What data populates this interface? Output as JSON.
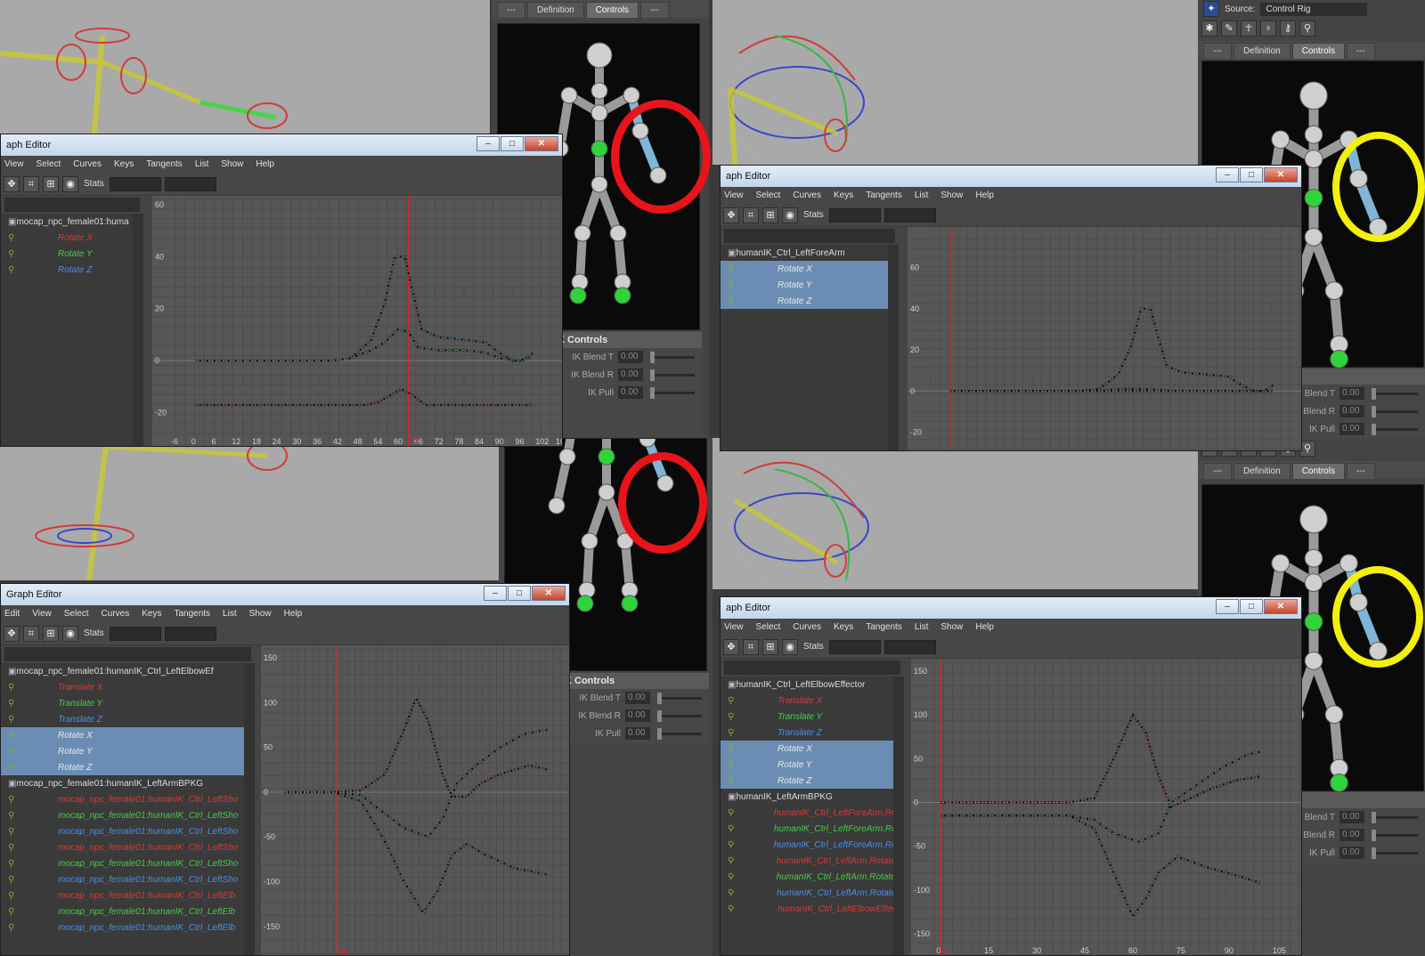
{
  "ik_tabs": {
    "left": "---",
    "definition": "Definition",
    "controls": "Controls",
    "right": "---"
  },
  "ik_top_right_source": {
    "label": "Source:",
    "value": "Control Rig"
  },
  "ik_controls_header_mid": "K Controls",
  "ik_controls_header_mid_top": "K Controls",
  "ik_controls_header_right": "trols",
  "ik_rows": [
    {
      "label": "IK Blend T",
      "value": "0.00"
    },
    {
      "label": "IK Blend R",
      "value": "0.00"
    },
    {
      "label": "IK Pull",
      "value": "0.00"
    }
  ],
  "ik_rows_right": [
    {
      "label": "Blend T",
      "value": "0.00"
    },
    {
      "label": "Blend R",
      "value": "0.00"
    },
    {
      "label": "IK Pull",
      "value": "0.00"
    }
  ],
  "highlight_colors": {
    "red": "#e8141a",
    "yellow": "#f3f00b"
  },
  "windows": {
    "tl": {
      "title": "aph Editor",
      "menu": [
        "View",
        "Select",
        "Curves",
        "Keys",
        "Tangents",
        "List",
        "Show",
        "Help"
      ],
      "stats": "Stats",
      "outliner": [
        {
          "text": "mocap_npc_female01:huma",
          "kind": "node",
          "color": "#e5e5e5"
        },
        {
          "text": "Rotate X",
          "kind": "curve",
          "color": "#d93a3a"
        },
        {
          "text": "Rotate Y",
          "kind": "curve",
          "color": "#49c94b"
        },
        {
          "text": "Rotate Z",
          "kind": "curve",
          "color": "#4a8fe8"
        }
      ]
    },
    "tr": {
      "title": "aph Editor",
      "menu": [
        "View",
        "Select",
        "Curves",
        "Keys",
        "Tangents",
        "List",
        "Show",
        "Help"
      ],
      "stats": "Stats",
      "outliner": [
        {
          "text": "humanIK_Ctrl_LeftForeArm",
          "kind": "node",
          "color": "#e5e5e5"
        },
        {
          "text": "Rotate X",
          "kind": "curve",
          "color": "#e8e8e8",
          "sel": true
        },
        {
          "text": "Rotate Y",
          "kind": "curve",
          "color": "#e8e8e8",
          "sel": true
        },
        {
          "text": "Rotate Z",
          "kind": "curve",
          "color": "#e8e8e8",
          "sel": true
        }
      ]
    },
    "bl": {
      "title": "Graph Editor",
      "menu": [
        "Edit",
        "View",
        "Select",
        "Curves",
        "Keys",
        "Tangents",
        "List",
        "Show",
        "Help"
      ],
      "stats": "Stats",
      "outliner": [
        {
          "text": "mocap_npc_female01:humanIK_Ctrl_LeftElbowEf",
          "kind": "node",
          "color": "#e5e5e5"
        },
        {
          "text": "Translate X",
          "kind": "curve",
          "color": "#d93a3a"
        },
        {
          "text": "Translate Y",
          "kind": "curve",
          "color": "#49c94b"
        },
        {
          "text": "Translate Z",
          "kind": "curve",
          "color": "#4a8fe8"
        },
        {
          "text": "Rotate X",
          "kind": "curve",
          "color": "#e8e8e8",
          "sel": true
        },
        {
          "text": "Rotate Y",
          "kind": "curve",
          "color": "#e8e8e8",
          "sel": true
        },
        {
          "text": "Rotate Z",
          "kind": "curve",
          "color": "#e8e8e8",
          "sel": true
        },
        {
          "text": "mocap_npc_female01:humanIK_LeftArmBPKG",
          "kind": "node",
          "color": "#e5e5e5"
        },
        {
          "text": "mocap_npc_female01:humanIK_Ctrl_LeftSho",
          "kind": "curve",
          "color": "#d93a3a"
        },
        {
          "text": "mocap_npc_female01:humanIK_Ctrl_LeftSho",
          "kind": "curve",
          "color": "#49c94b"
        },
        {
          "text": "mocap_npc_female01:humanIK_Ctrl_LeftSho",
          "kind": "curve",
          "color": "#4a8fe8"
        },
        {
          "text": "mocap_npc_female01:humanIK_Ctrl_LeftSho",
          "kind": "curve",
          "color": "#d93a3a"
        },
        {
          "text": "mocap_npc_female01:humanIK_Ctrl_LeftSho",
          "kind": "curve",
          "color": "#49c94b"
        },
        {
          "text": "mocap_npc_female01:humanIK_Ctrl_LeftSho",
          "kind": "curve",
          "color": "#4a8fe8"
        },
        {
          "text": "mocap_npc_female01:humanIK_Ctrl_LeftElb",
          "kind": "curve",
          "color": "#d93a3a"
        },
        {
          "text": "mocap_npc_female01:humanIK_Ctrl_LeftElb",
          "kind": "curve",
          "color": "#49c94b"
        },
        {
          "text": "mocap_npc_female01:humanIK_Ctrl_LeftElb",
          "kind": "curve",
          "color": "#4a8fe8"
        }
      ]
    },
    "br": {
      "title": "aph Editor",
      "menu": [
        "View",
        "Select",
        "Curves",
        "Keys",
        "Tangents",
        "List",
        "Show",
        "Help"
      ],
      "stats": "Stats",
      "outliner": [
        {
          "text": "humanIK_Ctrl_LeftElbowEffector",
          "kind": "node",
          "color": "#e5e5e5"
        },
        {
          "text": "Translate X",
          "kind": "curve",
          "color": "#d93a3a"
        },
        {
          "text": "Translate Y",
          "kind": "curve",
          "color": "#49c94b"
        },
        {
          "text": "Translate Z",
          "kind": "curve",
          "color": "#4a8fe8"
        },
        {
          "text": "Rotate X",
          "kind": "curve",
          "color": "#e8e8e8",
          "sel": true
        },
        {
          "text": "Rotate Y",
          "kind": "curve",
          "color": "#e8e8e8",
          "sel": true
        },
        {
          "text": "Rotate Z",
          "kind": "curve",
          "color": "#e8e8e8",
          "sel": true
        },
        {
          "text": "humanIK_LeftArmBPKG",
          "kind": "node",
          "color": "#e5e5e5"
        },
        {
          "text": "humanIK_Ctrl_LeftForeArm.Rota",
          "kind": "curve",
          "color": "#d93a3a"
        },
        {
          "text": "humanIK_Ctrl_LeftForeArm.Rota",
          "kind": "curve",
          "color": "#49c94b"
        },
        {
          "text": "humanIK_Ctrl_LeftForeArm.Rota",
          "kind": "curve",
          "color": "#4a8fe8"
        },
        {
          "text": "humanIK_Ctrl_LeftArm.Rotate X",
          "kind": "curve",
          "color": "#d93a3a"
        },
        {
          "text": "humanIK_Ctrl_LeftArm.Rotate Y",
          "kind": "curve",
          "color": "#49c94b"
        },
        {
          "text": "humanIK_Ctrl_LeftArm.Rotate Z",
          "kind": "curve",
          "color": "#4a8fe8"
        },
        {
          "text": "humanIK_Ctrl_LeftElbowEffecto",
          "kind": "curve",
          "color": "#d93a3a"
        }
      ]
    }
  },
  "chart_data": [
    {
      "type": "line",
      "panel": "tl",
      "xlim": [
        -6,
        108
      ],
      "ylim": [
        -28,
        62
      ],
      "xticks": [
        -6,
        0,
        6,
        12,
        18,
        24,
        30,
        36,
        42,
        48,
        54,
        60,
        66,
        72,
        78,
        84,
        90,
        96,
        102,
        108
      ],
      "yticks": [
        -20,
        0,
        20,
        40,
        60
      ],
      "current_time": 63,
      "current_time_label": "63",
      "series": [
        {
          "color": "#4a8fe8",
          "points": [
            [
              0,
              0
            ],
            [
              40,
              0
            ],
            [
              46,
              1
            ],
            [
              52,
              8
            ],
            [
              56,
              22
            ],
            [
              59,
              40
            ],
            [
              62,
              40
            ],
            [
              64,
              28
            ],
            [
              67,
              12
            ],
            [
              72,
              9
            ],
            [
              80,
              8
            ],
            [
              86,
              7
            ],
            [
              90,
              3
            ],
            [
              94,
              0
            ],
            [
              97,
              0
            ],
            [
              100,
              3
            ]
          ]
        },
        {
          "color": "#49c94b",
          "points": [
            [
              0,
              0
            ],
            [
              40,
              0
            ],
            [
              46,
              1
            ],
            [
              52,
              4
            ],
            [
              56,
              7
            ],
            [
              60,
              12
            ],
            [
              63,
              11
            ],
            [
              66,
              5
            ],
            [
              72,
              4
            ],
            [
              80,
              4
            ],
            [
              86,
              3
            ],
            [
              90,
              1
            ],
            [
              95,
              0
            ],
            [
              99,
              1
            ]
          ]
        },
        {
          "color": "#d93a3a",
          "points": [
            [
              0,
              -17
            ],
            [
              50,
              -17
            ],
            [
              54,
              -16
            ],
            [
              58,
              -13
            ],
            [
              61,
              -11
            ],
            [
              64,
              -13
            ],
            [
              68,
              -17
            ],
            [
              80,
              -17
            ],
            [
              100,
              -17
            ]
          ]
        }
      ]
    },
    {
      "type": "line",
      "panel": "tr",
      "xlim": [
        -6,
        108
      ],
      "ylim": [
        -28,
        78
      ],
      "xticks": [],
      "yticks": [
        -20,
        0,
        20,
        40,
        60
      ],
      "current_time": 0,
      "series": [
        {
          "color": "#4a8fe8",
          "points": [
            [
              0,
              0
            ],
            [
              40,
              0
            ],
            [
              46,
              1
            ],
            [
              52,
              8
            ],
            [
              56,
              22
            ],
            [
              59,
              40
            ],
            [
              62,
              40
            ],
            [
              64,
              28
            ],
            [
              67,
              12
            ],
            [
              72,
              9
            ],
            [
              80,
              8
            ],
            [
              86,
              7
            ],
            [
              90,
              3
            ],
            [
              94,
              0
            ],
            [
              97,
              0
            ],
            [
              100,
              3
            ]
          ]
        },
        {
          "color": "#49c94b",
          "points": [
            [
              0,
              0
            ],
            [
              40,
              0
            ],
            [
              46,
              0
            ],
            [
              52,
              1
            ],
            [
              60,
              1
            ],
            [
              70,
              0
            ],
            [
              90,
              0
            ],
            [
              100,
              0
            ]
          ]
        },
        {
          "color": "#d93a3a",
          "points": [
            [
              0,
              0
            ],
            [
              100,
              0
            ]
          ]
        }
      ]
    },
    {
      "type": "line",
      "panel": "bl",
      "xlim": [
        -10,
        108
      ],
      "ylim": [
        -180,
        160
      ],
      "xticks": [],
      "yticks": [
        -150,
        -100,
        -50,
        0,
        50,
        100,
        150
      ],
      "current_time": 12,
      "current_time_label": "59",
      "series": [
        {
          "color": "#d93a3a",
          "points": [
            [
              -10,
              0
            ],
            [
              10,
              0
            ],
            [
              22,
              2
            ],
            [
              32,
              20
            ],
            [
              40,
              70
            ],
            [
              45,
              105
            ],
            [
              50,
              80
            ],
            [
              56,
              20
            ],
            [
              60,
              -5
            ],
            [
              66,
              -5
            ],
            [
              72,
              10
            ],
            [
              80,
              20
            ],
            [
              92,
              30
            ],
            [
              100,
              25
            ]
          ]
        },
        {
          "color": "#49c94b",
          "points": [
            [
              -10,
              0
            ],
            [
              10,
              0
            ],
            [
              22,
              -3
            ],
            [
              30,
              -20
            ],
            [
              40,
              -40
            ],
            [
              50,
              -50
            ],
            [
              56,
              -30
            ],
            [
              62,
              10
            ],
            [
              70,
              30
            ],
            [
              80,
              50
            ],
            [
              90,
              65
            ],
            [
              100,
              70
            ]
          ]
        },
        {
          "color": "#4a8fe8",
          "points": [
            [
              -10,
              0
            ],
            [
              10,
              0
            ],
            [
              22,
              -10
            ],
            [
              32,
              -55
            ],
            [
              40,
              -100
            ],
            [
              48,
              -135
            ],
            [
              54,
              -110
            ],
            [
              60,
              -70
            ],
            [
              66,
              -58
            ],
            [
              74,
              -70
            ],
            [
              86,
              -85
            ],
            [
              100,
              -92
            ]
          ]
        }
      ]
    },
    {
      "type": "line",
      "panel": "br",
      "xlim": [
        -2,
        112
      ],
      "ylim": [
        -160,
        160
      ],
      "xticks": [
        0,
        15,
        30,
        45,
        60,
        75,
        90,
        105
      ],
      "yticks": [
        -150,
        -100,
        -50,
        0,
        50,
        100,
        150
      ],
      "current_time": 0,
      "current_time_label": "0",
      "series": [
        {
          "color": "#d93a3a",
          "points": [
            [
              0,
              0
            ],
            [
              40,
              0
            ],
            [
              48,
              5
            ],
            [
              54,
              50
            ],
            [
              60,
              100
            ],
            [
              64,
              80
            ],
            [
              68,
              30
            ],
            [
              72,
              -5
            ],
            [
              78,
              5
            ],
            [
              84,
              15
            ],
            [
              92,
              25
            ],
            [
              100,
              30
            ]
          ]
        },
        {
          "color": "#49c94b",
          "points": [
            [
              0,
              -15
            ],
            [
              40,
              -15
            ],
            [
              48,
              -20
            ],
            [
              54,
              -35
            ],
            [
              62,
              -45
            ],
            [
              68,
              -35
            ],
            [
              72,
              0
            ],
            [
              80,
              20
            ],
            [
              88,
              40
            ],
            [
              96,
              55
            ],
            [
              100,
              58
            ]
          ]
        },
        {
          "color": "#4a8fe8",
          "points": [
            [
              0,
              -15
            ],
            [
              40,
              -15
            ],
            [
              48,
              -30
            ],
            [
              54,
              -80
            ],
            [
              60,
              -130
            ],
            [
              64,
              -110
            ],
            [
              68,
              -80
            ],
            [
              74,
              -62
            ],
            [
              84,
              -75
            ],
            [
              94,
              -85
            ],
            [
              100,
              -92
            ]
          ]
        }
      ]
    }
  ]
}
